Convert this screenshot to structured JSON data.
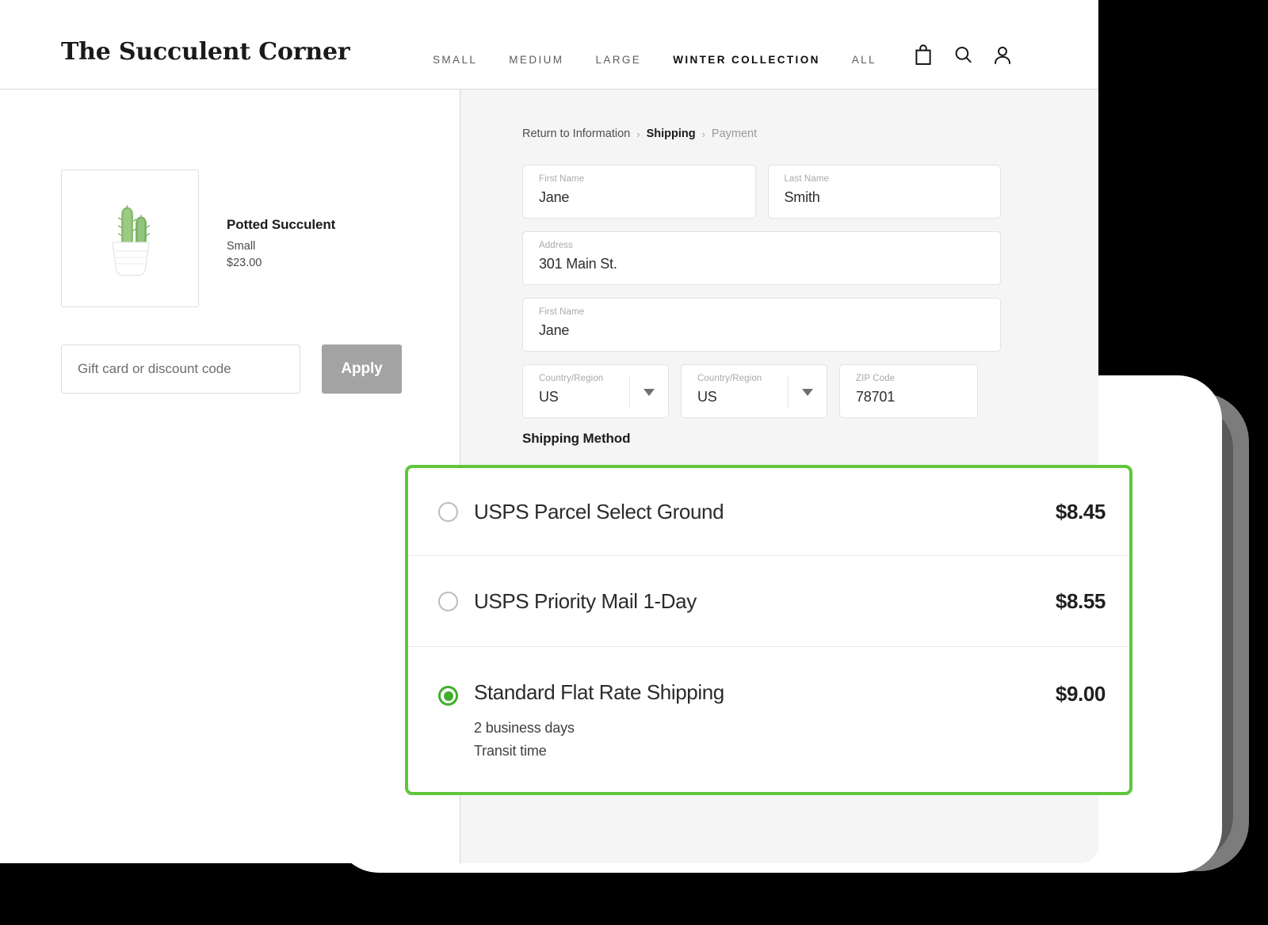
{
  "brand": {
    "name": "The Succulent Corner"
  },
  "nav": {
    "items": [
      {
        "label": "SMALL",
        "active": false
      },
      {
        "label": "MEDIUM",
        "active": false
      },
      {
        "label": "LARGE",
        "active": false
      },
      {
        "label": "WINTER COLLECTION",
        "active": true
      },
      {
        "label": "ALL",
        "active": false
      }
    ]
  },
  "header_icons": [
    {
      "name": "shopping-bag-icon"
    },
    {
      "name": "search-icon"
    },
    {
      "name": "account-icon"
    }
  ],
  "product": {
    "name": "Potted Succulent",
    "variant": "Small",
    "price": "$23.00",
    "image_alt": "potted-cactus"
  },
  "discount": {
    "placeholder": "Gift card or discount code",
    "value": "",
    "apply_label": "Apply"
  },
  "breadcrumb": {
    "back": "Return to Information",
    "separator": "›",
    "current": "Shipping",
    "next": "Payment"
  },
  "form": {
    "fields": [
      {
        "label": "First Name",
        "value": "Jane",
        "type": "text"
      },
      {
        "label": "Last Name",
        "value": "Smith",
        "type": "text"
      },
      {
        "label": "Address",
        "value": "301 Main St.",
        "type": "text"
      },
      {
        "label": "First Name",
        "value": "Jane",
        "type": "text"
      },
      {
        "label": "Country/Region",
        "value": "US",
        "type": "select"
      },
      {
        "label": "Country/Region",
        "value": "US",
        "type": "select"
      },
      {
        "label": "ZIP Code",
        "value": "78701",
        "type": "text"
      }
    ]
  },
  "shipping": {
    "heading": "Shipping Method",
    "accent_color": "#5fc63c",
    "selected_color": "#3fae2a",
    "options": [
      {
        "label": "USPS Parcel Select Ground",
        "price": "$8.45",
        "selected": false,
        "detail_line1": "",
        "detail_line2": ""
      },
      {
        "label": "USPS Priority Mail 1-Day",
        "price": "$8.55",
        "selected": false,
        "detail_line1": "",
        "detail_line2": ""
      },
      {
        "label": "Standard Flat Rate Shipping",
        "price": "$9.00",
        "selected": true,
        "detail_line1": "2 business days",
        "detail_line2": "Transit time"
      }
    ]
  }
}
